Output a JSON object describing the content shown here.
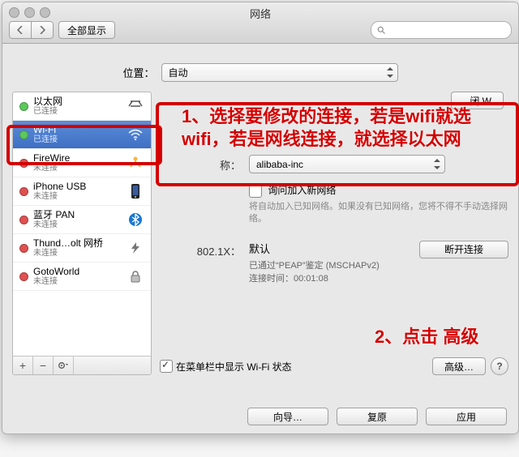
{
  "window": {
    "title": "网络"
  },
  "toolbar": {
    "show_all": "全部显示"
  },
  "location": {
    "label": "位置：",
    "value": "自动"
  },
  "sidebar": {
    "items": [
      {
        "name": "以太网",
        "status": "已连接",
        "dot": "dot-green",
        "icon": "ethernet-icon"
      },
      {
        "name": "Wi-Fi",
        "status": "已连接",
        "dot": "dot-green",
        "icon": "wifi-icon",
        "selected": true
      },
      {
        "name": "FireWire",
        "status": "未连接",
        "dot": "dot-red",
        "icon": "firewire-icon"
      },
      {
        "name": "iPhone USB",
        "status": "未连接",
        "dot": "dot-red",
        "icon": "iphone-icon"
      },
      {
        "name": "蓝牙 PAN",
        "status": "未连接",
        "dot": "dot-red",
        "icon": "bluetooth-icon"
      },
      {
        "name": "Thund…olt 网桥",
        "status": "未连接",
        "dot": "dot-red",
        "icon": "thunderbolt-icon"
      },
      {
        "name": "GotoWorld",
        "status": "未连接",
        "dot": "dot-red",
        "icon": "lock-icon"
      }
    ]
  },
  "detail": {
    "turn_off_partial": "闭 W",
    "network_name_label_suffix": "称：",
    "network_name_value": "alibaba-inc",
    "ask_join_label": "询问加入新网络",
    "ask_join_help": "将自动加入已知网络。如果没有已知网络，您将不得不手动选择网络。",
    "dot1x_label": "802.1X：",
    "dot1x_value": "默认",
    "disconnect": "断开连接",
    "auth_line1": "已通过“PEAP”鉴定 (MSCHAPv2)",
    "auth_line2": "连接时间：00:01:08",
    "show_in_menubar": "在菜单栏中显示 Wi-Fi 状态",
    "advanced": "高级…"
  },
  "footer": {
    "assist": "向导…",
    "revert": "复原",
    "apply": "应用"
  },
  "annotations": {
    "a1": "1、选择要修改的连接，若是wifi就选wifi，若是网线连接，就选择以太网",
    "a2": "2、点击 高级"
  }
}
